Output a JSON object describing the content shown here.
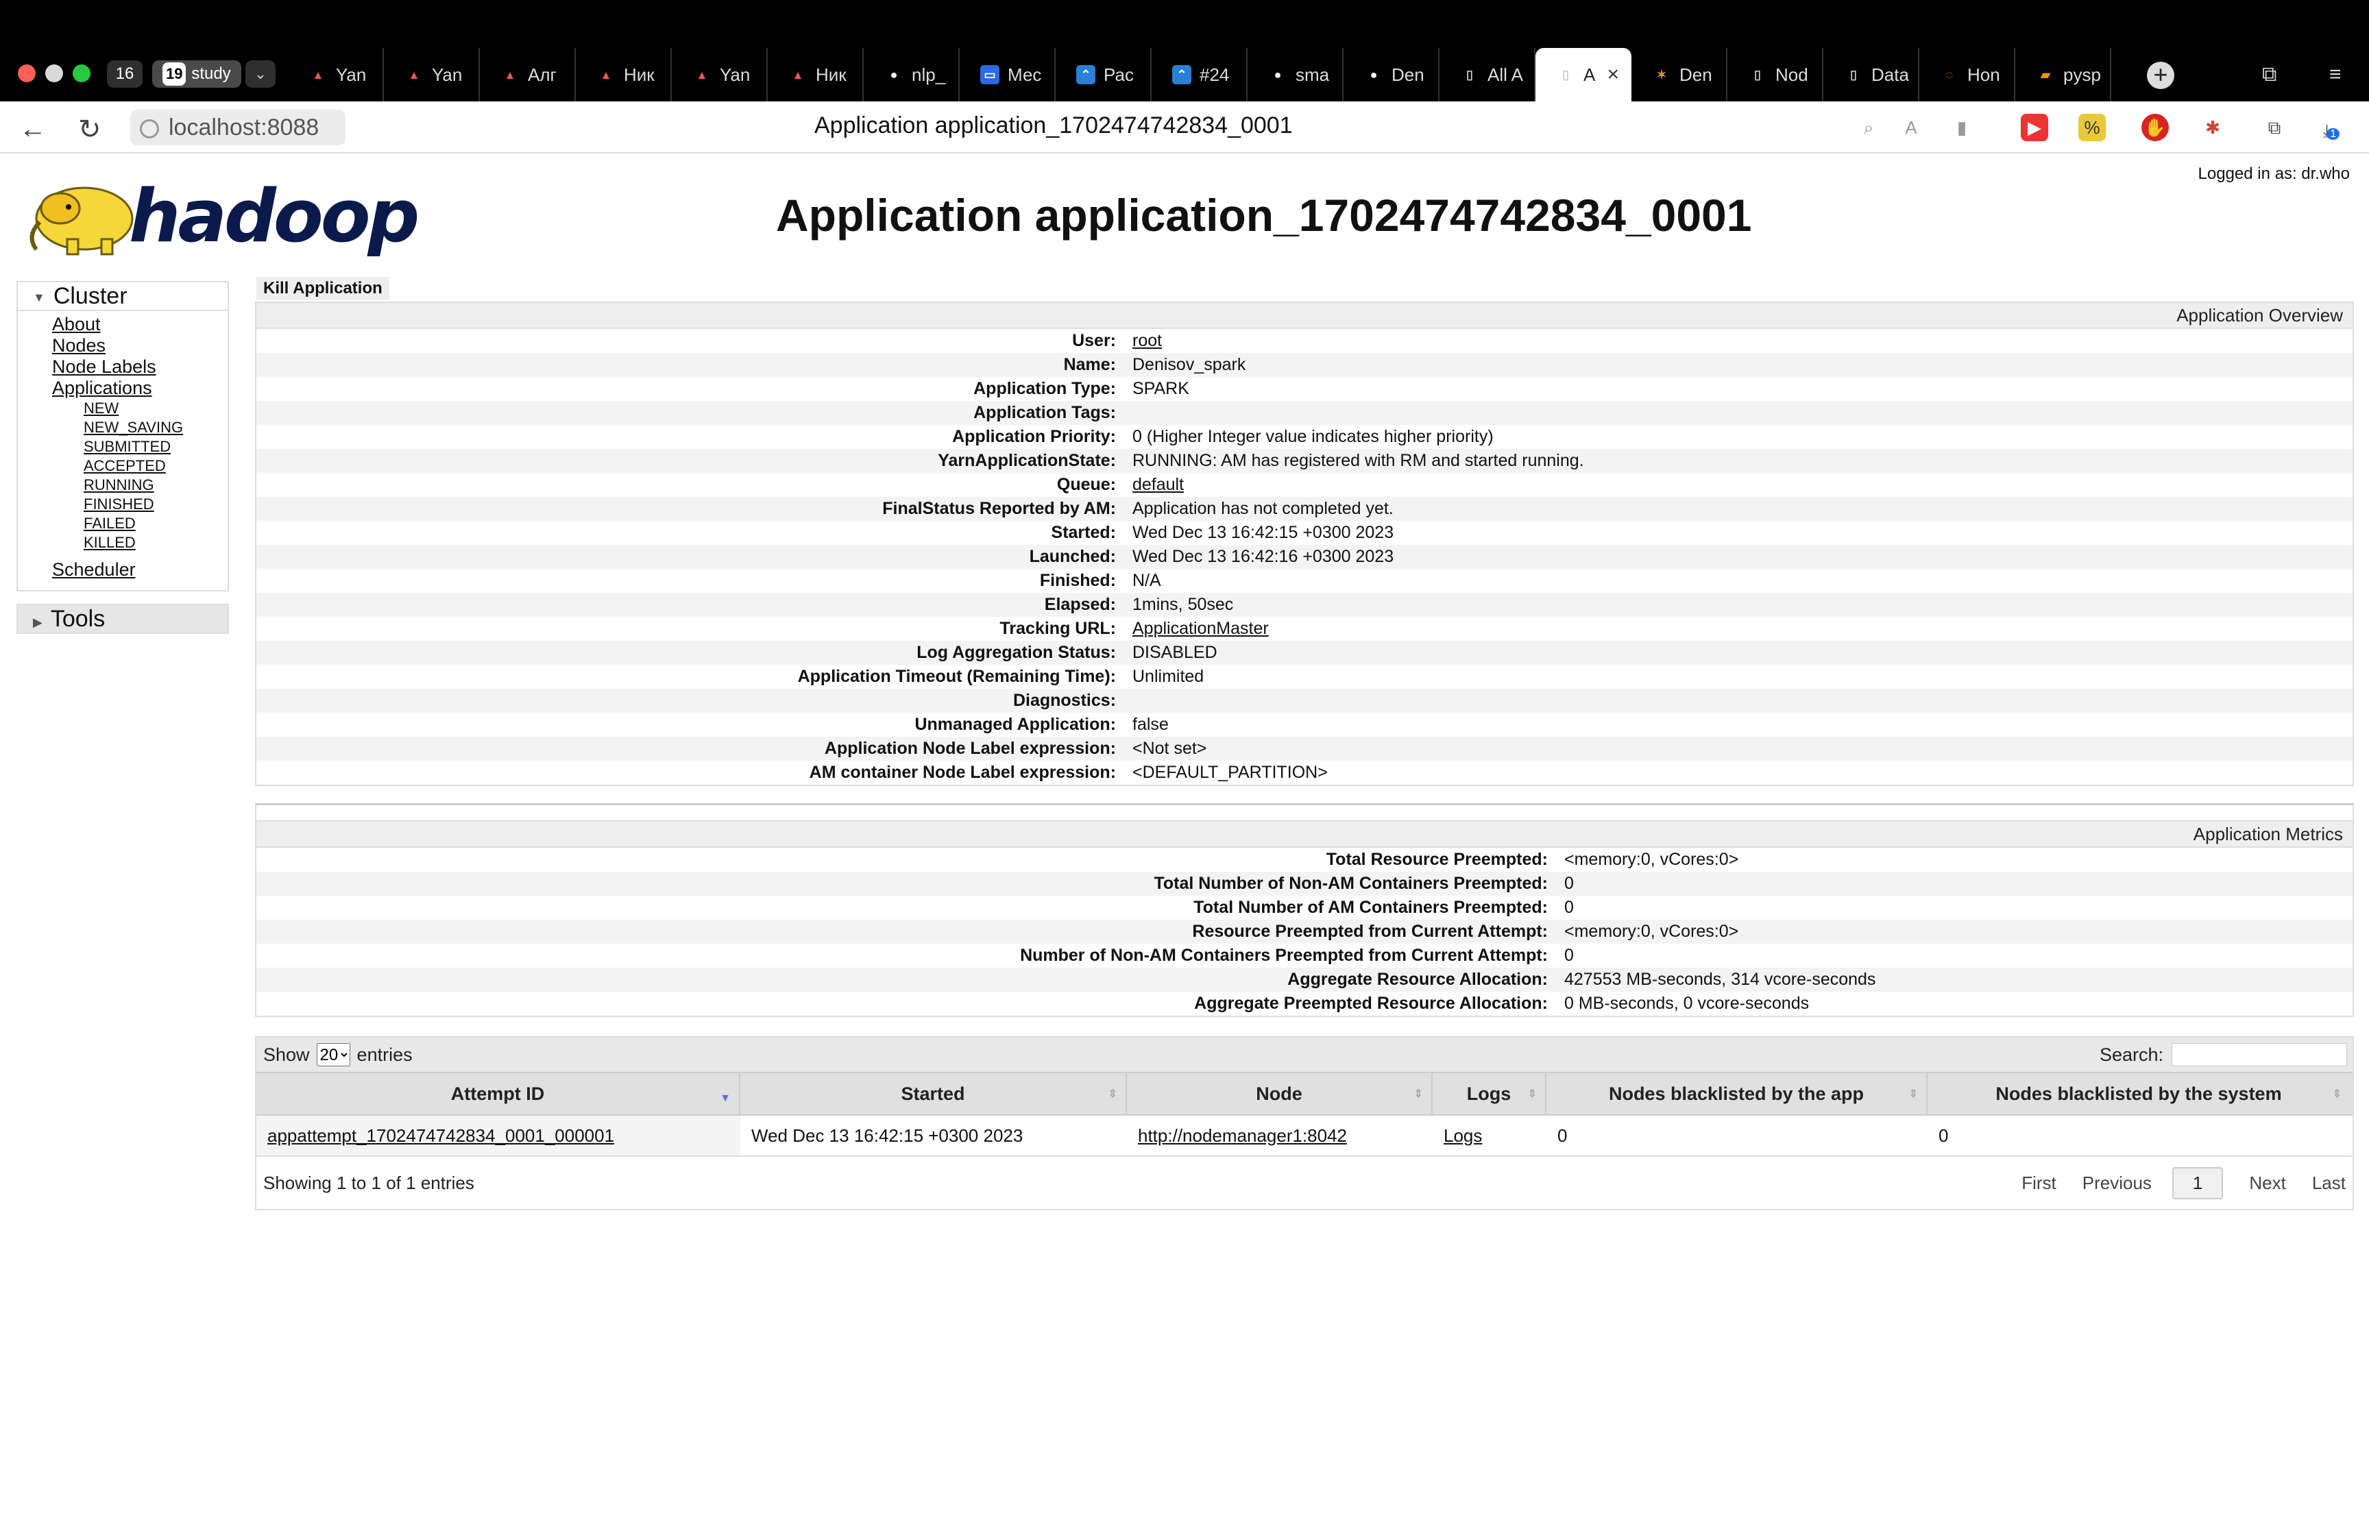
{
  "browser": {
    "tab_count": "16",
    "group_count": "19",
    "group_name": "study",
    "tabs": [
      {
        "label": "Yan",
        "icon": "yandex-icon"
      },
      {
        "label": "Yan",
        "icon": "yandex-icon"
      },
      {
        "label": "Алг",
        "icon": "yandex-icon"
      },
      {
        "label": "Ник",
        "icon": "yandex-icon"
      },
      {
        "label": "Yan",
        "icon": "yandex-icon"
      },
      {
        "label": "Ник",
        "icon": "yandex-icon"
      },
      {
        "label": "nlp_",
        "icon": "github-icon"
      },
      {
        "label": "Мес",
        "icon": "chat-icon"
      },
      {
        "label": "Рас",
        "icon": "confluence-icon"
      },
      {
        "label": "#24",
        "icon": "confluence-icon"
      },
      {
        "label": "sma",
        "icon": "github-icon"
      },
      {
        "label": "Den",
        "icon": "github-icon"
      },
      {
        "label": "All A",
        "icon": "page-icon"
      },
      {
        "label": "A",
        "icon": "page-icon",
        "active": true
      },
      {
        "label": "Den",
        "icon": "spark-icon"
      },
      {
        "label": "Nod",
        "icon": "page-icon"
      },
      {
        "label": "Data",
        "icon": "page-icon"
      },
      {
        "label": "Hon",
        "icon": "jupyter-icon"
      },
      {
        "label": "pysp",
        "icon": "book-icon"
      }
    ],
    "url": "localhost:8088",
    "page_title": "Application application_1702474742834_0001",
    "download_badge": "1"
  },
  "page": {
    "logo_text": "hadoop",
    "logged_in": "Logged in as: dr.who",
    "title": "Application application_1702474742834_0001"
  },
  "sidebar": {
    "cluster_label": "Cluster",
    "items": [
      "About",
      "Nodes",
      "Node Labels",
      "Applications"
    ],
    "app_states": [
      "NEW",
      "NEW_SAVING",
      "SUBMITTED",
      "ACCEPTED",
      "RUNNING",
      "FINISHED",
      "FAILED",
      "KILLED"
    ],
    "scheduler": "Scheduler",
    "tools_label": "Tools"
  },
  "kill_button": "Kill Application",
  "overview": {
    "heading": "Application Overview",
    "rows": [
      {
        "k": "User:",
        "v": "root",
        "link": true
      },
      {
        "k": "Name:",
        "v": "Denisov_spark"
      },
      {
        "k": "Application Type:",
        "v": "SPARK"
      },
      {
        "k": "Application Tags:",
        "v": ""
      },
      {
        "k": "Application Priority:",
        "v": "0 (Higher Integer value indicates higher priority)"
      },
      {
        "k": "YarnApplicationState:",
        "v": "RUNNING: AM has registered with RM and started running."
      },
      {
        "k": "Queue:",
        "v": "default",
        "link": true
      },
      {
        "k": "FinalStatus Reported by AM:",
        "v": "Application has not completed yet."
      },
      {
        "k": "Started:",
        "v": "Wed Dec 13 16:42:15 +0300 2023"
      },
      {
        "k": "Launched:",
        "v": "Wed Dec 13 16:42:16 +0300 2023"
      },
      {
        "k": "Finished:",
        "v": "N/A"
      },
      {
        "k": "Elapsed:",
        "v": "1mins, 50sec"
      },
      {
        "k": "Tracking URL:",
        "v": "ApplicationMaster",
        "link": true
      },
      {
        "k": "Log Aggregation Status:",
        "v": "DISABLED"
      },
      {
        "k": "Application Timeout (Remaining Time):",
        "v": "Unlimited"
      },
      {
        "k": "Diagnostics:",
        "v": ""
      },
      {
        "k": "Unmanaged Application:",
        "v": "false"
      },
      {
        "k": "Application Node Label expression:",
        "v": "<Not set>"
      },
      {
        "k": "AM container Node Label expression:",
        "v": "<DEFAULT_PARTITION>"
      }
    ]
  },
  "metrics": {
    "heading": "Application Metrics",
    "rows": [
      {
        "k": "Total Resource Preempted:",
        "v": "<memory:0, vCores:0>"
      },
      {
        "k": "Total Number of Non-AM Containers Preempted:",
        "v": "0"
      },
      {
        "k": "Total Number of AM Containers Preempted:",
        "v": "0"
      },
      {
        "k": "Resource Preempted from Current Attempt:",
        "v": "<memory:0, vCores:0>"
      },
      {
        "k": "Number of Non-AM Containers Preempted from Current Attempt:",
        "v": "0"
      },
      {
        "k": "Aggregate Resource Allocation:",
        "v": "427553 MB-seconds, 314 vcore-seconds"
      },
      {
        "k": "Aggregate Preempted Resource Allocation:",
        "v": "0 MB-seconds, 0 vcore-seconds"
      }
    ]
  },
  "attempts": {
    "show_label": "Show",
    "entries_value": "20",
    "entries_label": "entries",
    "search_label": "Search:",
    "columns": [
      "Attempt ID",
      "Started",
      "Node",
      "Logs",
      "Nodes blacklisted by the app",
      "Nodes blacklisted by the system"
    ],
    "rows": [
      {
        "attempt_id": "appattempt_1702474742834_0001_000001",
        "started": "Wed Dec 13 16:42:15 +0300 2023",
        "node": "http://nodemanager1:8042",
        "logs": "Logs",
        "bl_app": "0",
        "bl_sys": "0"
      }
    ],
    "info": "Showing 1 to 1 of 1 entries",
    "pager": {
      "first": "First",
      "previous": "Previous",
      "current": "1",
      "next": "Next",
      "last": "Last"
    }
  }
}
